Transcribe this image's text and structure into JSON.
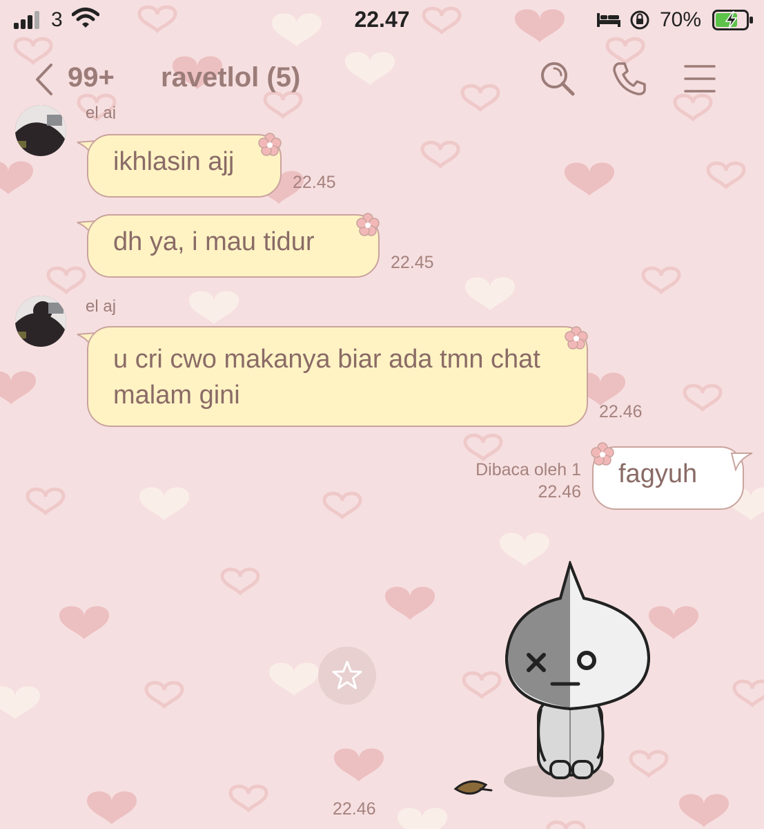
{
  "status_bar": {
    "carrier": "3",
    "time": "22.47",
    "battery_percent": "70%",
    "icons": [
      "signal-icon",
      "wifi-icon",
      "bed-icon",
      "rotation-lock-icon",
      "battery-charging-icon"
    ]
  },
  "header": {
    "back_count": "99+",
    "title": "ravetlol (5)",
    "icons": [
      "back-chevron-icon",
      "search-icon",
      "phone-icon",
      "menu-icon"
    ]
  },
  "messages": [
    {
      "direction": "in",
      "sender": "el aj",
      "text": "ikhlasin ajj",
      "time": "22.45"
    },
    {
      "direction": "in",
      "sender": "",
      "text": "dh ya, i mau tidur",
      "time": "22.45"
    },
    {
      "direction": "in",
      "sender": "el aj",
      "text": "u cri cwo makanya biar ada tmn chat malam gini",
      "time": "22.46"
    },
    {
      "direction": "out",
      "text": "fagyuh",
      "read_status": "Dibaca oleh 1",
      "time": "22.46"
    },
    {
      "direction": "out",
      "type": "sticker",
      "sticker": "sad-ghost-character",
      "time": "22.46"
    }
  ],
  "colors": {
    "background": "#f6dfe0",
    "incoming_bubble": "#fff3c4",
    "outgoing_bubble": "#ffffff",
    "bubble_border": "#c9a39d",
    "text": "#8a6b66"
  }
}
